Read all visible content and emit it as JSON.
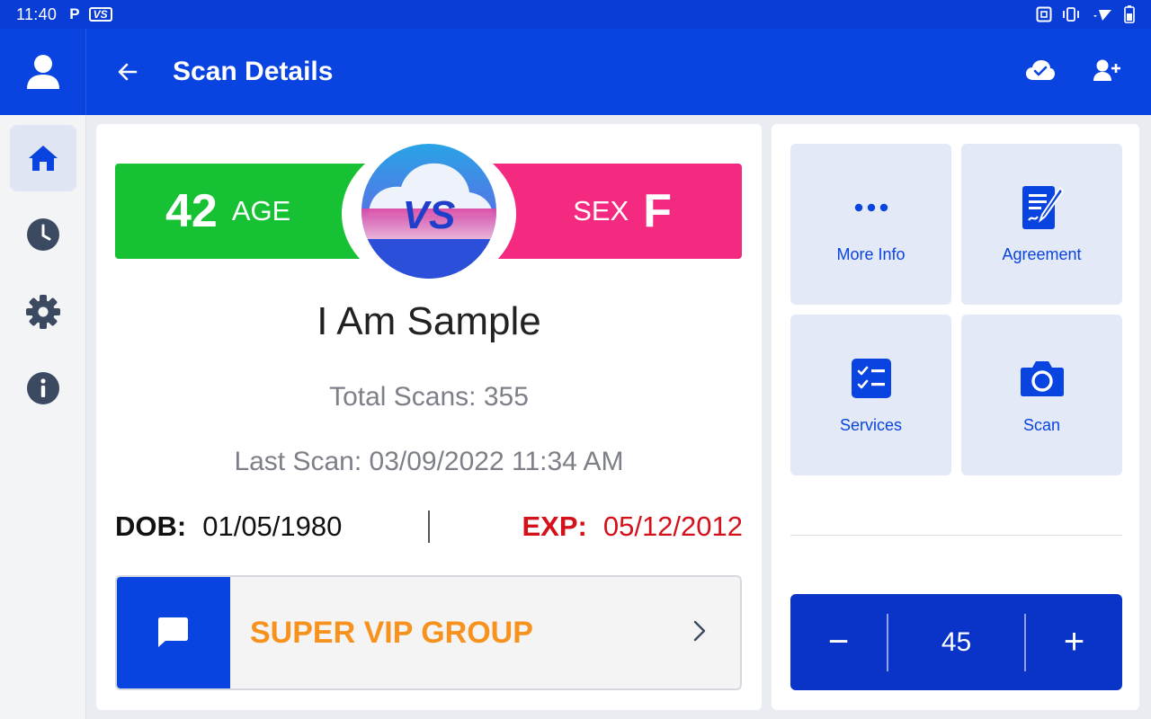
{
  "status_bar": {
    "time": "11:40",
    "left_icons": [
      "parking-icon",
      "app-logo-icon"
    ],
    "right_icons": [
      "nfc-icon",
      "vibrate-icon",
      "wifi-icon",
      "battery-icon"
    ]
  },
  "app_bar": {
    "title": "Scan Details",
    "actions": [
      "cloud-sync-icon",
      "add-user-icon"
    ]
  },
  "side_rail": {
    "items": [
      "home-icon",
      "history-icon",
      "settings-icon",
      "info-icon"
    ],
    "active": "home"
  },
  "profile": {
    "age_value": "42",
    "age_label": "AGE",
    "sex_label": "SEX",
    "sex_value": "F",
    "logo_text": "VS",
    "name": "I Am Sample",
    "total_scans": "Total Scans: 355",
    "last_scan": "Last Scan: 03/09/2022 11:34 AM",
    "dob_label": "DOB:",
    "dob_value": "01/05/1980",
    "exp_label": "EXP:",
    "exp_value": "05/12/2012",
    "group_name": "SUPER VIP GROUP"
  },
  "actions": {
    "more_info": "More Info",
    "agreement": "Agreement",
    "services": "Services",
    "scan": "Scan"
  },
  "stepper": {
    "minus": "−",
    "value": "45",
    "plus": "+"
  },
  "colors": {
    "primary": "#0a44e0",
    "age_green": "#16c233",
    "sex_pink": "#f42a80",
    "exp_red": "#d4101a",
    "group_orange": "#f7921e"
  }
}
